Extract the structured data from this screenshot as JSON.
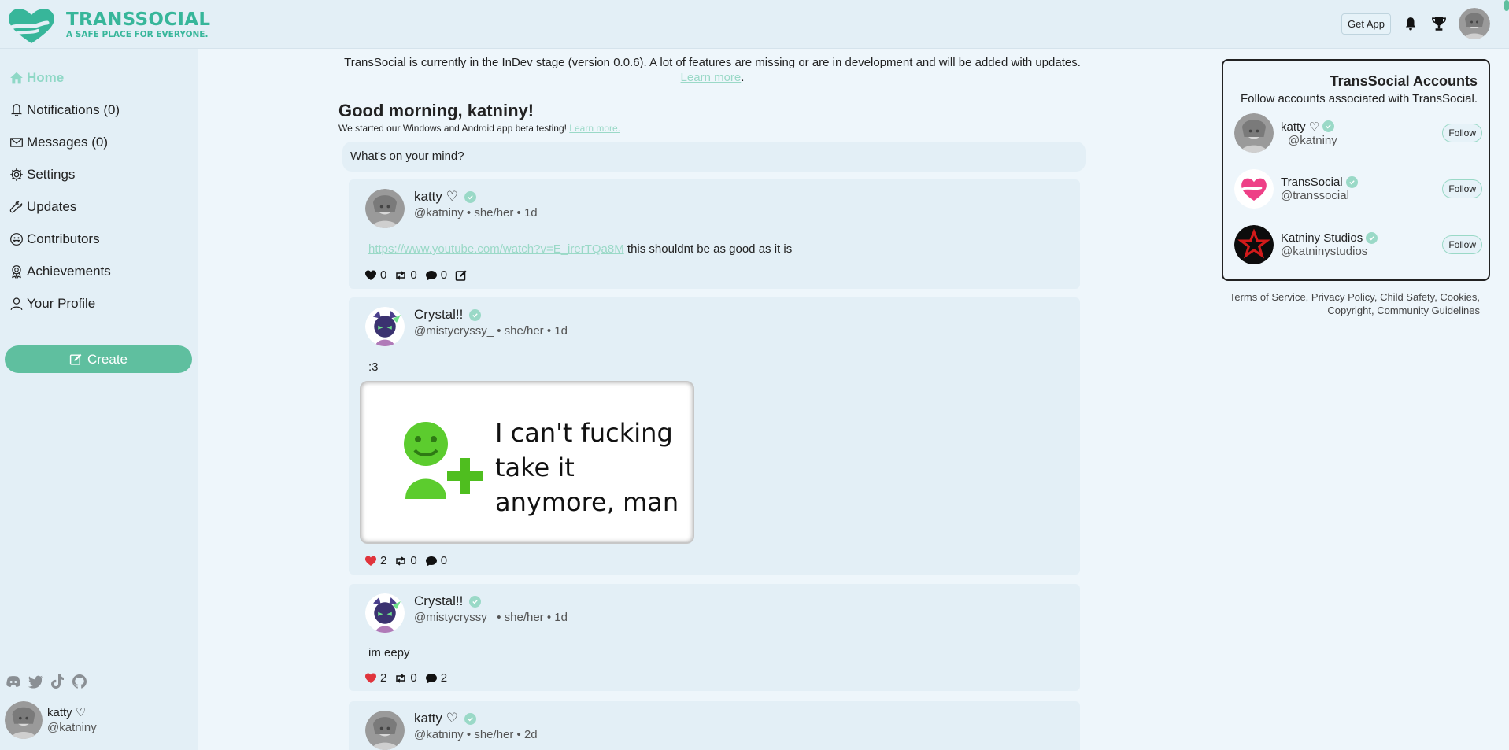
{
  "brand": {
    "name": "TRANSSOCIAL",
    "tagline": "A SAFE PLACE FOR EVERYONE.",
    "accent": "#37b69a"
  },
  "topbar": {
    "get_app": "Get App",
    "icons": [
      "bell-icon",
      "trophy-icon",
      "avatar"
    ]
  },
  "sidebar": {
    "items": [
      {
        "label": "Home",
        "icon": "home-icon"
      },
      {
        "label": "Notifications (0)",
        "icon": "bell-icon"
      },
      {
        "label": "Messages (0)",
        "icon": "envelope-icon"
      },
      {
        "label": "Settings",
        "icon": "gear-icon"
      },
      {
        "label": "Updates",
        "icon": "wrench-icon"
      },
      {
        "label": "Contributors",
        "icon": "smile-icon"
      },
      {
        "label": "Achievements",
        "icon": "award-icon"
      },
      {
        "label": "Your Profile",
        "icon": "person-icon"
      }
    ],
    "create_label": "Create",
    "socials": [
      "discord-icon",
      "twitter-icon",
      "tiktok-icon",
      "github-icon"
    ],
    "user": {
      "name": "katty ♡",
      "handle": "@katniny"
    }
  },
  "main": {
    "notice_text": "TransSocial is currently in the InDev stage (version 0.0.6). A lot of features are missing or are in development and will be added with updates.",
    "notice_link": "Learn more",
    "greeting": "Good morning, katniny!",
    "greeting_sub": "We started our Windows and Android app beta testing!",
    "greeting_link": "Learn more.",
    "compose_placeholder": "What's on your mind?"
  },
  "posts": [
    {
      "name": "katty ♡",
      "meta": "@katniny • she/her • 1d",
      "link": "https://www.youtube.com/watch?v=E_irerTQa8M",
      "text": "this shouldnt be as good as it is",
      "likes": "0",
      "reposts": "0",
      "comments": "0",
      "liked": false
    },
    {
      "name": "Crystal!!",
      "meta": "@mistycryssy_ • she/her • 1d",
      "text": ":3",
      "image_text": "I can't fucking take it anymore, man",
      "likes": "2",
      "reposts": "0",
      "comments": "0",
      "liked": true
    },
    {
      "name": "Crystal!!",
      "meta": "@mistycryssy_ • she/her • 1d",
      "text": "im eepy",
      "likes": "2",
      "reposts": "0",
      "comments": "2",
      "liked": true
    },
    {
      "name": "katty ♡",
      "meta": "@katniny • she/her • 2d"
    }
  ],
  "right_panel": {
    "title": "TransSocial Accounts",
    "subtitle": "Follow accounts associated with TransSocial.",
    "accounts": [
      {
        "name": "katty ♡",
        "handle": "@katniny",
        "follow": "Follow"
      },
      {
        "name": "TransSocial",
        "handle": "@transsocial",
        "follow": "Follow"
      },
      {
        "name": "Katniny Studios",
        "handle": "@katninystudios",
        "follow": "Follow"
      }
    ],
    "footer_line1": "Terms of Service, Privacy Policy, Child Safety, Cookies,",
    "footer_line2": "Copyright, Community Guidelines"
  }
}
